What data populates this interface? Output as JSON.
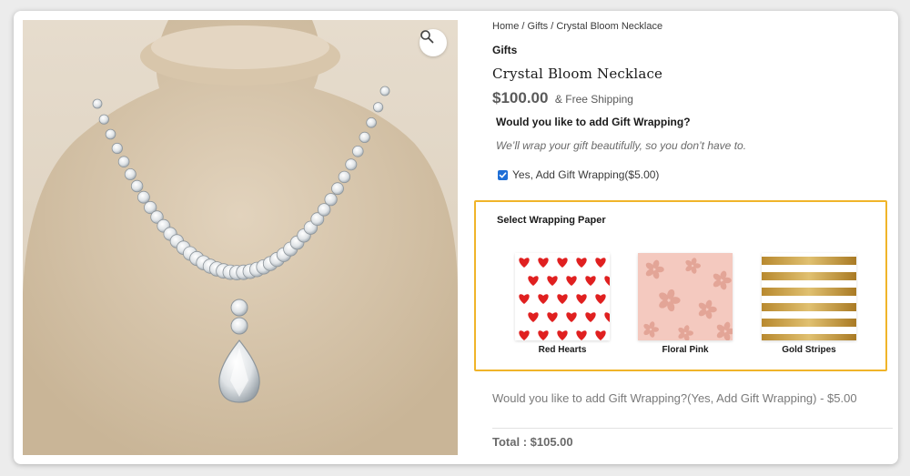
{
  "breadcrumb": {
    "items": [
      "Home",
      "Gifts",
      "Crystal Bloom Necklace"
    ],
    "separator": " / "
  },
  "product": {
    "category": "Gifts",
    "title": "Crystal Bloom Necklace",
    "price": "$100.00",
    "shipping": "& Free Shipping",
    "image_icon": "zoom-icon"
  },
  "gift_wrap": {
    "question": "Would you like to add Gift Wrapping?",
    "subtitle": "We’ll wrap your gift beautifully, so you don’t have to.",
    "checkbox_label": "Yes, Add Gift Wrapping($5.00)",
    "checked": true
  },
  "wrapping_paper": {
    "heading": "Select Wrapping Paper",
    "options": [
      {
        "label": "Red Hearts",
        "colors": [
          "#ffffff",
          "#e02020"
        ]
      },
      {
        "label": "Floral Pink",
        "colors": [
          "#f4c9bf",
          "#e3a597"
        ]
      },
      {
        "label": "Gold Stripes",
        "colors": [
          "#ffffff",
          "#c49a3c"
        ]
      }
    ]
  },
  "summary": {
    "line": "Would you like to add Gift Wrapping?(Yes, Add Gift Wrapping) - $5.00",
    "total": "Total : $105.00"
  },
  "colors": {
    "highlight_border": "#f0b429",
    "checkbox": "#1f6fd6"
  }
}
